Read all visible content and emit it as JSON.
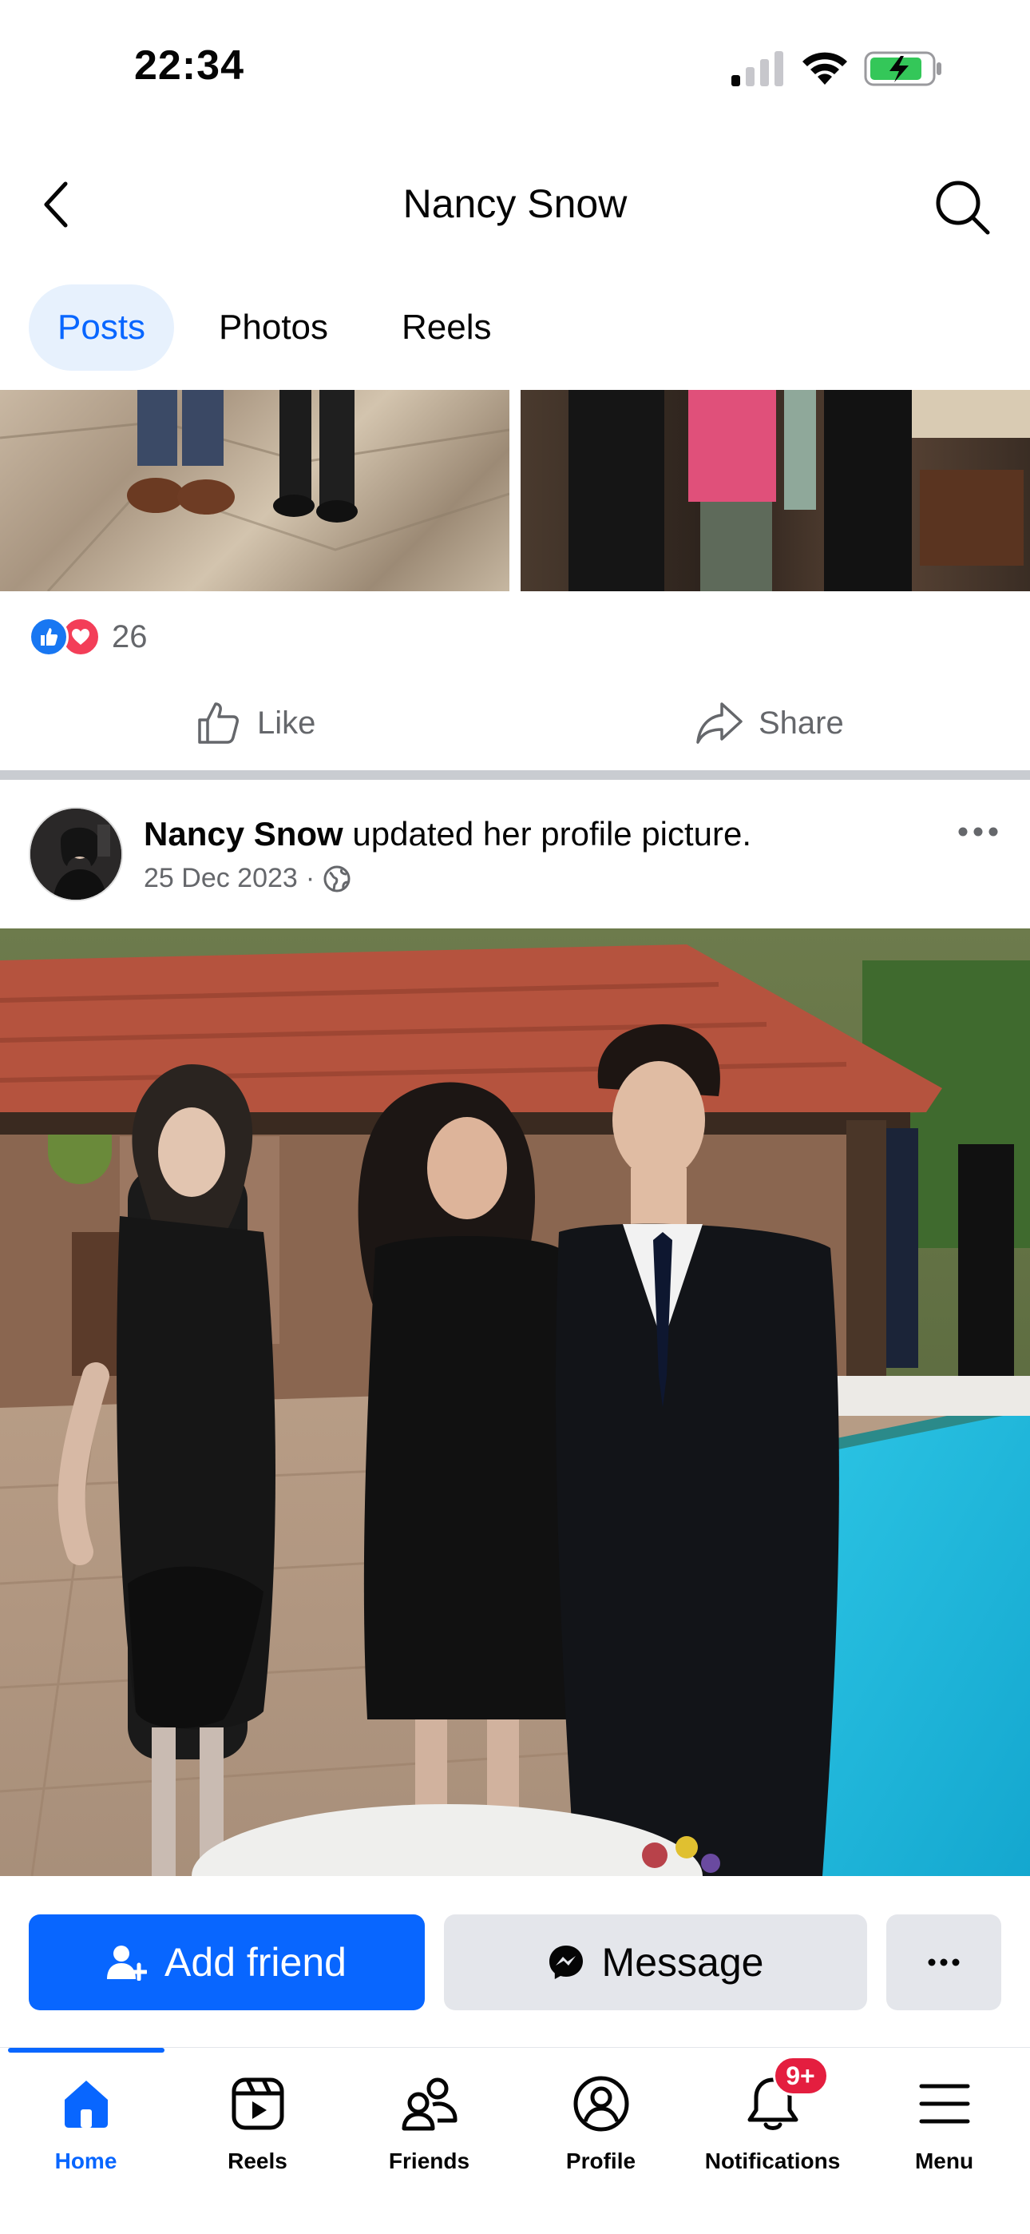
{
  "status_bar": {
    "time": "22:34"
  },
  "header": {
    "title": "Nancy Snow"
  },
  "tabs": [
    {
      "label": "Posts",
      "active": true
    },
    {
      "label": "Photos",
      "active": false
    },
    {
      "label": "Reels",
      "active": false
    }
  ],
  "previous_post": {
    "reaction_count": "26",
    "like_label": "Like",
    "share_label": "Share"
  },
  "post": {
    "author": "Nancy Snow",
    "action_text": " updated her profile picture.",
    "date": "25 Dec 2023",
    "separator": "·",
    "audience_icon": "globe-icon"
  },
  "profile_actions": {
    "add_friend": "Add friend",
    "message": "Message"
  },
  "bottom_nav": {
    "items": [
      {
        "label": "Home",
        "icon": "home-icon",
        "active": true
      },
      {
        "label": "Reels",
        "icon": "reels-icon",
        "active": false
      },
      {
        "label": "Friends",
        "icon": "friends-icon",
        "active": false
      },
      {
        "label": "Profile",
        "icon": "profile-icon",
        "active": false
      },
      {
        "label": "Notifications",
        "icon": "bell-icon",
        "active": false,
        "badge": "9+"
      },
      {
        "label": "Menu",
        "icon": "menu-icon",
        "active": false
      }
    ]
  },
  "colors": {
    "accent": "#0866ff",
    "tab_active_bg": "#e7f1fd",
    "secondary_button": "#e4e6eb",
    "badge": "#e41e3f",
    "like_reaction": "#1877f2",
    "love_reaction": "#f33e58"
  }
}
